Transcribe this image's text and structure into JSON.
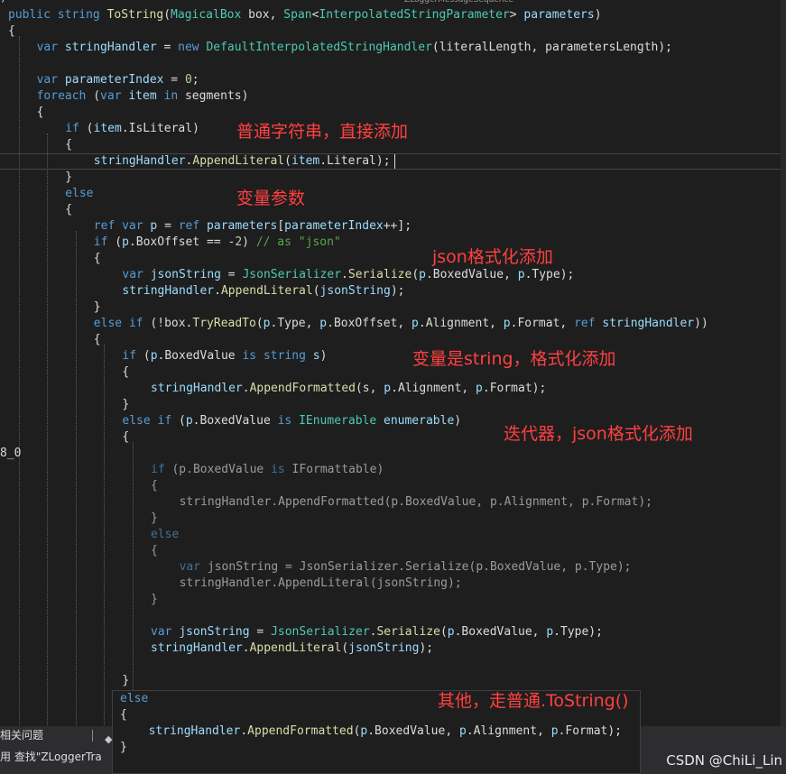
{
  "colors": {
    "keyword": "#569cd6",
    "type": "#4ec9b0",
    "method": "#dcdcaa",
    "variable": "#9cdcfe",
    "number": "#b5cea8",
    "string": "#d69d85",
    "comment": "#57a64a",
    "plain": "#dcdcdc",
    "annotation": "#ff4040",
    "background": "#1e1e1e"
  },
  "window": {
    "top_tab_fragment": "ZLoggerMessageSequence",
    "top_left_fragment": ")"
  },
  "code_lines": [
    {
      "indent": 0,
      "tokens": [
        [
          "public",
          "keyword"
        ],
        [
          " ",
          "plain"
        ],
        [
          "string",
          "keyword"
        ],
        [
          " ",
          "plain"
        ],
        [
          "ToString",
          "method"
        ],
        [
          "(",
          "plain"
        ],
        [
          "MagicalBox",
          "type"
        ],
        [
          " box, ",
          "plain"
        ],
        [
          "Span",
          "type"
        ],
        [
          "<",
          "plain"
        ],
        [
          "InterpolatedStringParameter",
          "type"
        ],
        [
          "> ",
          "plain"
        ],
        [
          "parameters",
          "variable"
        ],
        [
          ")",
          "plain"
        ]
      ]
    },
    {
      "indent": 0,
      "tokens": [
        [
          "{",
          "plain"
        ]
      ]
    },
    {
      "indent": 1,
      "tokens": [
        [
          "var",
          "keyword"
        ],
        [
          " ",
          "plain"
        ],
        [
          "stringHandler",
          "variable"
        ],
        [
          " = ",
          "plain"
        ],
        [
          "new",
          "keyword"
        ],
        [
          " ",
          "plain"
        ],
        [
          "DefaultInterpolatedStringHandler",
          "type"
        ],
        [
          "(literalLength, parametersLength);",
          "plain"
        ]
      ]
    },
    {
      "indent": 1,
      "tokens": []
    },
    {
      "indent": 1,
      "tokens": [
        [
          "var",
          "keyword"
        ],
        [
          " ",
          "plain"
        ],
        [
          "parameterIndex",
          "variable"
        ],
        [
          " = ",
          "plain"
        ],
        [
          "0",
          "number"
        ],
        [
          ";",
          "plain"
        ]
      ]
    },
    {
      "indent": 1,
      "tokens": [
        [
          "foreach",
          "keyword"
        ],
        [
          " (",
          "plain"
        ],
        [
          "var",
          "keyword"
        ],
        [
          " ",
          "plain"
        ],
        [
          "item",
          "variable"
        ],
        [
          " ",
          "plain"
        ],
        [
          "in",
          "keyword"
        ],
        [
          " segments)",
          "plain"
        ]
      ]
    },
    {
      "indent": 1,
      "tokens": [
        [
          "{",
          "plain"
        ]
      ]
    },
    {
      "indent": 2,
      "tokens": [
        [
          "if",
          "keyword"
        ],
        [
          " (",
          "plain"
        ],
        [
          "item",
          "variable"
        ],
        [
          ".IsLiteral)",
          "plain"
        ]
      ]
    },
    {
      "indent": 2,
      "tokens": [
        [
          "{",
          "plain"
        ]
      ]
    },
    {
      "indent": 3,
      "tokens": [
        [
          "stringHandler",
          "variable"
        ],
        [
          ".",
          "plain"
        ],
        [
          "AppendLiteral",
          "method"
        ],
        [
          "(",
          "plain"
        ],
        [
          "item",
          "variable"
        ],
        [
          ".Literal);",
          "plain"
        ]
      ]
    },
    {
      "indent": 2,
      "tokens": [
        [
          "}",
          "plain"
        ]
      ]
    },
    {
      "indent": 2,
      "tokens": [
        [
          "else",
          "keyword"
        ]
      ]
    },
    {
      "indent": 2,
      "tokens": [
        [
          "{",
          "plain"
        ]
      ]
    },
    {
      "indent": 3,
      "tokens": [
        [
          "ref",
          "keyword"
        ],
        [
          " ",
          "plain"
        ],
        [
          "var",
          "keyword"
        ],
        [
          " ",
          "plain"
        ],
        [
          "p",
          "variable"
        ],
        [
          " = ",
          "plain"
        ],
        [
          "ref",
          "keyword"
        ],
        [
          " ",
          "plain"
        ],
        [
          "parameters",
          "variable"
        ],
        [
          "[",
          "plain"
        ],
        [
          "parameterIndex",
          "variable"
        ],
        [
          "++];",
          "plain"
        ]
      ]
    },
    {
      "indent": 3,
      "tokens": [
        [
          "if",
          "keyword"
        ],
        [
          " (",
          "plain"
        ],
        [
          "p",
          "variable"
        ],
        [
          ".BoxOffset == -",
          "plain"
        ],
        [
          "2",
          "number"
        ],
        [
          ") ",
          "plain"
        ],
        [
          "// as \"json\"",
          "comment"
        ]
      ]
    },
    {
      "indent": 3,
      "tokens": [
        [
          "{",
          "plain"
        ]
      ]
    },
    {
      "indent": 4,
      "tokens": [
        [
          "var",
          "keyword"
        ],
        [
          " ",
          "plain"
        ],
        [
          "jsonString",
          "variable"
        ],
        [
          " = ",
          "plain"
        ],
        [
          "JsonSerializer",
          "type"
        ],
        [
          ".",
          "plain"
        ],
        [
          "Serialize",
          "method"
        ],
        [
          "(",
          "plain"
        ],
        [
          "p",
          "variable"
        ],
        [
          ".BoxedValue, ",
          "plain"
        ],
        [
          "p",
          "variable"
        ],
        [
          ".Type);",
          "plain"
        ]
      ]
    },
    {
      "indent": 4,
      "tokens": [
        [
          "stringHandler",
          "variable"
        ],
        [
          ".",
          "plain"
        ],
        [
          "AppendLiteral",
          "method"
        ],
        [
          "(",
          "plain"
        ],
        [
          "jsonString",
          "variable"
        ],
        [
          ");",
          "plain"
        ]
      ]
    },
    {
      "indent": 3,
      "tokens": [
        [
          "}",
          "plain"
        ]
      ]
    },
    {
      "indent": 3,
      "tokens": [
        [
          "else",
          "keyword"
        ],
        [
          " ",
          "plain"
        ],
        [
          "if",
          "keyword"
        ],
        [
          " (!box.",
          "plain"
        ],
        [
          "TryReadTo",
          "method"
        ],
        [
          "(",
          "plain"
        ],
        [
          "p",
          "variable"
        ],
        [
          ".Type, ",
          "plain"
        ],
        [
          "p",
          "variable"
        ],
        [
          ".BoxOffset, ",
          "plain"
        ],
        [
          "p",
          "variable"
        ],
        [
          ".Alignment, ",
          "plain"
        ],
        [
          "p",
          "variable"
        ],
        [
          ".Format, ",
          "plain"
        ],
        [
          "ref",
          "keyword"
        ],
        [
          " ",
          "plain"
        ],
        [
          "stringHandler",
          "variable"
        ],
        [
          "))",
          "plain"
        ]
      ]
    },
    {
      "indent": 3,
      "tokens": [
        [
          "{",
          "plain"
        ]
      ]
    },
    {
      "indent": 4,
      "tokens": [
        [
          "if",
          "keyword"
        ],
        [
          " (",
          "plain"
        ],
        [
          "p",
          "variable"
        ],
        [
          ".BoxedValue ",
          "plain"
        ],
        [
          "is",
          "keyword"
        ],
        [
          " ",
          "plain"
        ],
        [
          "string",
          "keyword"
        ],
        [
          " ",
          "plain"
        ],
        [
          "s",
          "variable"
        ],
        [
          ")",
          "plain"
        ]
      ]
    },
    {
      "indent": 4,
      "tokens": [
        [
          "{",
          "plain"
        ]
      ]
    },
    {
      "indent": 5,
      "tokens": [
        [
          "stringHandler",
          "variable"
        ],
        [
          ".",
          "plain"
        ],
        [
          "AppendFormatted",
          "method"
        ],
        [
          "(s, ",
          "plain"
        ],
        [
          "p",
          "variable"
        ],
        [
          ".Alignment, ",
          "plain"
        ],
        [
          "p",
          "variable"
        ],
        [
          ".Format);",
          "plain"
        ]
      ]
    },
    {
      "indent": 4,
      "tokens": [
        [
          "}",
          "plain"
        ]
      ]
    },
    {
      "indent": 4,
      "tokens": [
        [
          "else",
          "keyword"
        ],
        [
          " ",
          "plain"
        ],
        [
          "if",
          "keyword"
        ],
        [
          " (",
          "plain"
        ],
        [
          "p",
          "variable"
        ],
        [
          ".BoxedValue ",
          "plain"
        ],
        [
          "is",
          "keyword"
        ],
        [
          " ",
          "plain"
        ],
        [
          "IEnumerable",
          "type"
        ],
        [
          " ",
          "plain"
        ],
        [
          "enumerable",
          "variable"
        ],
        [
          ")",
          "plain"
        ]
      ]
    },
    {
      "indent": 4,
      "tokens": [
        [
          "{",
          "plain"
        ]
      ]
    },
    {
      "indent": 4,
      "tokens": []
    },
    {
      "indent": 5,
      "dim": true,
      "tokens": [
        [
          "if",
          "keyword"
        ],
        [
          " (p.BoxedValue ",
          "plain"
        ],
        [
          "is",
          "keyword"
        ],
        [
          " IFormattable)",
          "plain"
        ]
      ]
    },
    {
      "indent": 5,
      "dim": true,
      "tokens": [
        [
          "{",
          "plain"
        ]
      ]
    },
    {
      "indent": 6,
      "dim": true,
      "tokens": [
        [
          "stringHandler.AppendFormatted(p.BoxedValue, p.Alignment, p.Format);",
          "plain"
        ]
      ]
    },
    {
      "indent": 5,
      "dim": true,
      "tokens": [
        [
          "}",
          "plain"
        ]
      ]
    },
    {
      "indent": 5,
      "dim": true,
      "tokens": [
        [
          "else",
          "keyword"
        ]
      ]
    },
    {
      "indent": 5,
      "dim": true,
      "tokens": [
        [
          "{",
          "plain"
        ]
      ]
    },
    {
      "indent": 6,
      "dim": true,
      "tokens": [
        [
          "var",
          "keyword"
        ],
        [
          " jsonString = JsonSerializer.Serialize(p.BoxedValue, p.Type);",
          "plain"
        ]
      ]
    },
    {
      "indent": 6,
      "dim": true,
      "tokens": [
        [
          "stringHandler.AppendLiteral(jsonString);",
          "plain"
        ]
      ]
    },
    {
      "indent": 5,
      "dim": true,
      "tokens": [
        [
          "}",
          "plain"
        ]
      ]
    },
    {
      "indent": 5,
      "tokens": []
    },
    {
      "indent": 5,
      "tokens": [
        [
          "var",
          "keyword"
        ],
        [
          " ",
          "plain"
        ],
        [
          "jsonString",
          "variable"
        ],
        [
          " = ",
          "plain"
        ],
        [
          "JsonSerializer",
          "type"
        ],
        [
          ".",
          "plain"
        ],
        [
          "Serialize",
          "method"
        ],
        [
          "(",
          "plain"
        ],
        [
          "p",
          "variable"
        ],
        [
          ".BoxedValue, ",
          "plain"
        ],
        [
          "p",
          "variable"
        ],
        [
          ".Type);",
          "plain"
        ]
      ]
    },
    {
      "indent": 5,
      "tokens": [
        [
          "stringHandler",
          "variable"
        ],
        [
          ".",
          "plain"
        ],
        [
          "AppendLiteral",
          "method"
        ],
        [
          "(",
          "plain"
        ],
        [
          "jsonString",
          "variable"
        ],
        [
          ");",
          "plain"
        ]
      ]
    },
    {
      "indent": 5,
      "tokens": []
    },
    {
      "indent": 4,
      "tokens": [
        [
          "}",
          "plain"
        ]
      ]
    }
  ],
  "peek_lines": [
    {
      "indent": 0,
      "tokens": [
        [
          "else",
          "keyword"
        ]
      ]
    },
    {
      "indent": 0,
      "tokens": [
        [
          "{",
          "plain"
        ]
      ]
    },
    {
      "indent": 1,
      "tokens": [
        [
          "stringHandler",
          "variable"
        ],
        [
          ".",
          "plain"
        ],
        [
          "AppendFormatted",
          "method"
        ],
        [
          "(",
          "plain"
        ],
        [
          "p",
          "variable"
        ],
        [
          ".BoxedValue, ",
          "plain"
        ],
        [
          "p",
          "variable"
        ],
        [
          ".Alignment, ",
          "plain"
        ],
        [
          "p",
          "variable"
        ],
        [
          ".Format);",
          "plain"
        ]
      ]
    },
    {
      "indent": 0,
      "tokens": [
        [
          "}",
          "plain"
        ]
      ]
    }
  ],
  "annotations": {
    "literal": "普通字符串，直接添加",
    "variable": "变量参数",
    "json": "json格式化添加",
    "string": "变量是string，格式化添加",
    "enumerable": "迭代器，json格式化添加",
    "other": "其他，走普通.ToString()"
  },
  "left_fragment": "8_0",
  "bottom_panel": {
    "tab_label": "相关问题",
    "status_text": "用  查找\"ZLoggerTra"
  },
  "watermark": "CSDN @ChiLi_Lin"
}
